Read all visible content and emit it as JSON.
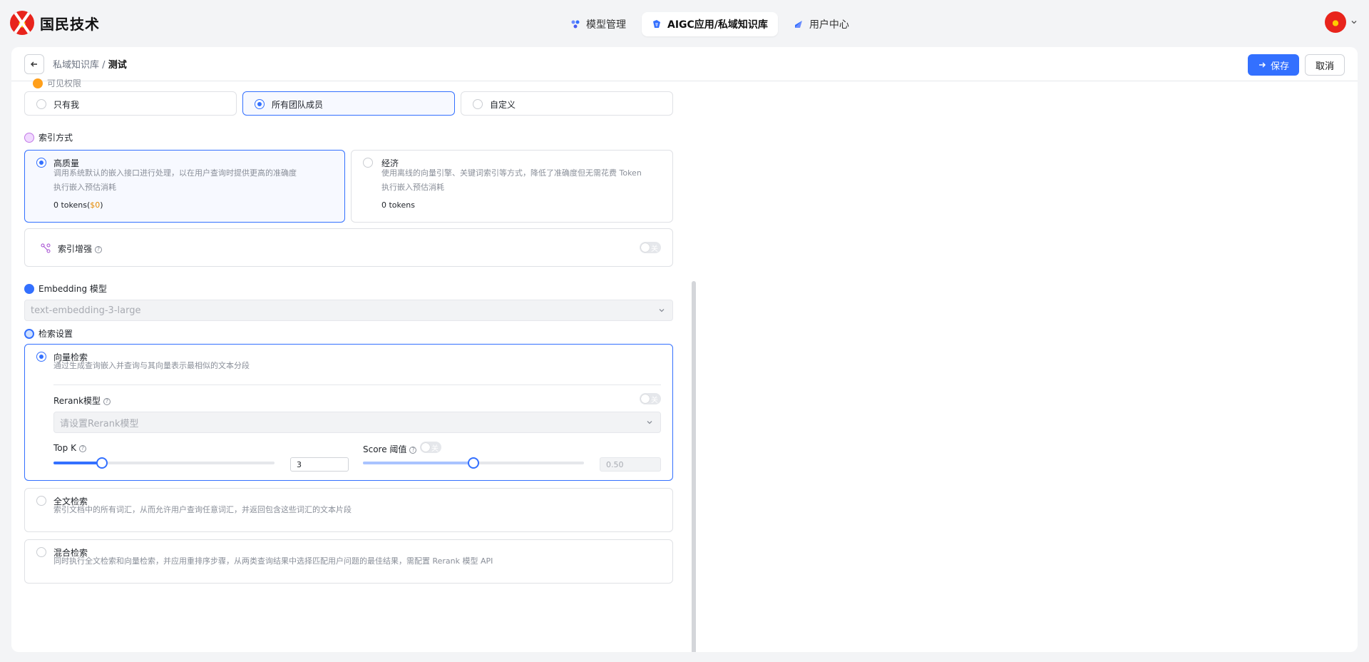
{
  "app": {
    "logo_text": "国民技术"
  },
  "nav": {
    "tabs": [
      {
        "label": "模型管理",
        "icon": "model-icon"
      },
      {
        "label": "AIGC应用/私域知识库",
        "icon": "knowledge-icon",
        "active": true
      },
      {
        "label": "用户中心",
        "icon": "user-center-icon"
      }
    ]
  },
  "header": {
    "breadcrumb_parent": "私域知识库",
    "breadcrumb_sep": "/",
    "breadcrumb_current": "测试",
    "save_label": "保存",
    "cancel_label": "取消"
  },
  "visibility": {
    "title": "可见权限",
    "options": [
      "只有我",
      "所有团队成员",
      "自定义"
    ],
    "selected": 1
  },
  "index_mode": {
    "title": "索引方式",
    "high_quality": {
      "label": "高质量",
      "desc": "调用系统默认的嵌入接口进行处理，以在用户查询时提供更高的准确度",
      "estimate_label": "执行嵌入预估消耗",
      "tokens": "0 tokens(",
      "price": "$0",
      "close": ")"
    },
    "economy": {
      "label": "经济",
      "desc": "使用离线的向量引擎、关键词索引等方式，降低了准确度但无需花费 Token",
      "estimate_label": "执行嵌入预估消耗",
      "tokens": "0 tokens"
    }
  },
  "index_boost": {
    "label": "索引增强",
    "toggle": "关"
  },
  "embedding": {
    "title": "Embedding 模型",
    "value": "text-embedding-3-large"
  },
  "retrieval": {
    "title": "检索设置",
    "vector": {
      "label": "向量检索",
      "desc": "通过生成查询嵌入并查询与其向量表示最相似的文本分段",
      "rerank_label": "Rerank模型",
      "rerank_toggle": "关",
      "rerank_placeholder": "请设置Rerank模型",
      "topk_label": "Top K",
      "topk_value": "3",
      "topk_fraction": 0.22,
      "score_label": "Score 阈值",
      "score_toggle": "关",
      "score_value": "0.50",
      "score_fraction": 0.5
    },
    "fulltext": {
      "label": "全文检索",
      "desc": "索引文档中的所有词汇，从而允许用户查询任意词汇，并返回包含这些词汇的文本片段"
    },
    "hybrid": {
      "label": "混合检索",
      "desc": "同时执行全文检索和向量检索，并应用重排序步骤，从两类查询结果中选择匹配用户问题的最佳结果，需配置 Rerank 模型 API"
    }
  },
  "colors": {
    "accent": "#3370ff",
    "price": "#e58a00"
  }
}
